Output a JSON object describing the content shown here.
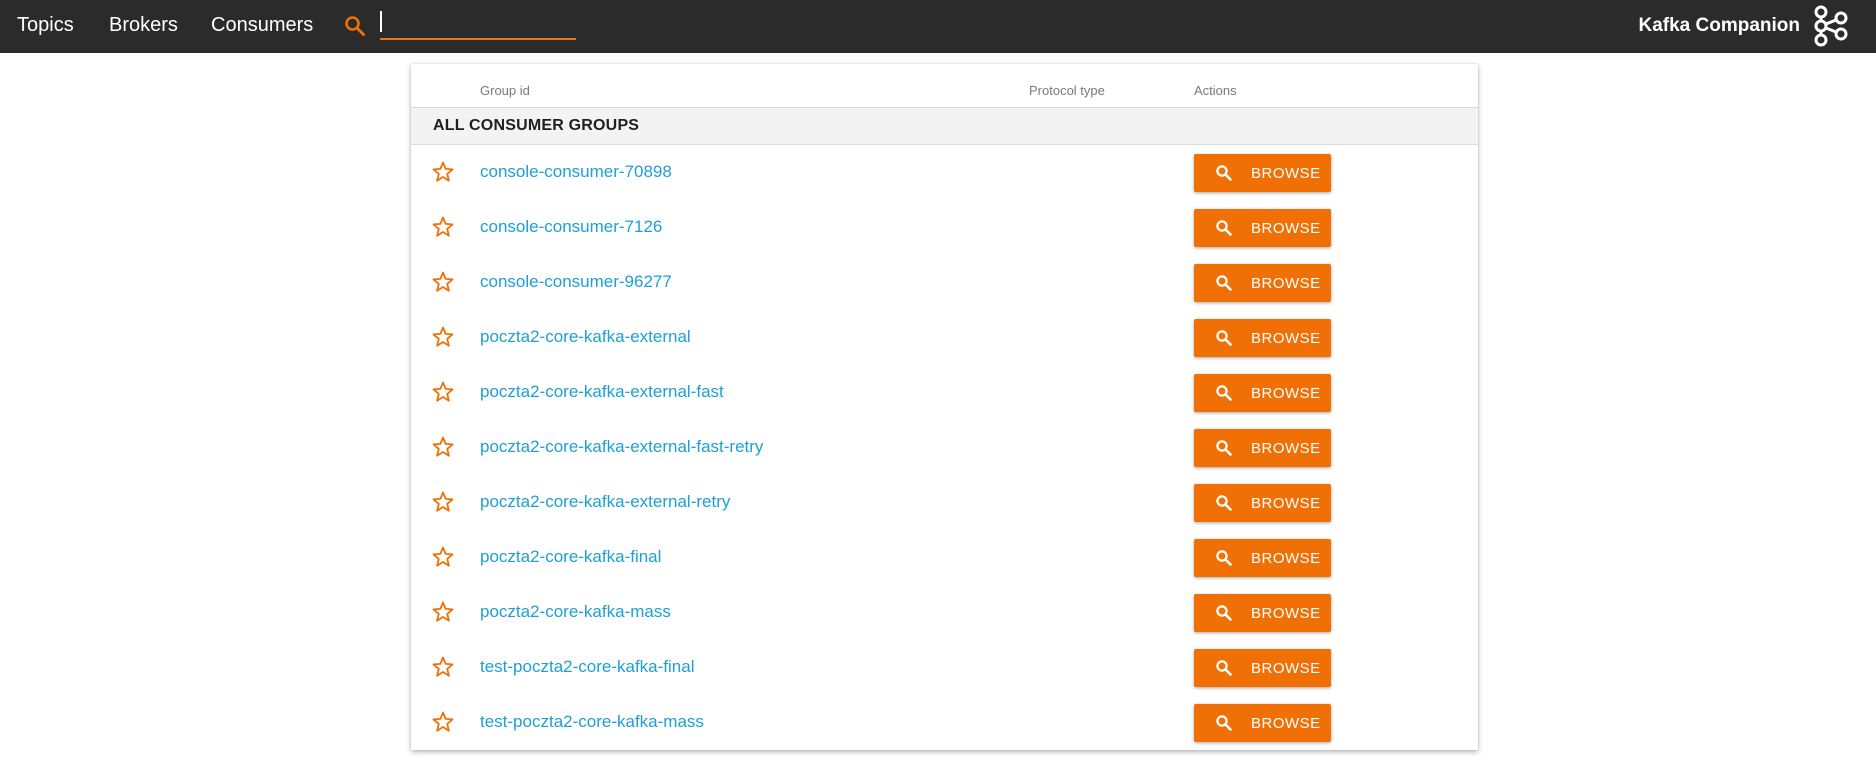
{
  "nav": {
    "topics": "Topics",
    "brokers": "Brokers",
    "consumers": "Consumers"
  },
  "search": {
    "value": "",
    "placeholder": ""
  },
  "brand": {
    "name": "Kafka Companion",
    "logo_icon": "kafka-logo-icon"
  },
  "table": {
    "columns": {
      "group_id": "Group id",
      "protocol_type": "Protocol type",
      "actions": "Actions"
    },
    "section_title": "ALL CONSUMER GROUPS",
    "browse_label": "BROWSE",
    "rows": [
      {
        "group_id": "console-consumer-70898",
        "protocol_type": ""
      },
      {
        "group_id": "console-consumer-7126",
        "protocol_type": ""
      },
      {
        "group_id": "console-consumer-96277",
        "protocol_type": ""
      },
      {
        "group_id": "poczta2-core-kafka-external",
        "protocol_type": ""
      },
      {
        "group_id": "poczta2-core-kafka-external-fast",
        "protocol_type": ""
      },
      {
        "group_id": "poczta2-core-kafka-external-fast-retry",
        "protocol_type": ""
      },
      {
        "group_id": "poczta2-core-kafka-external-retry",
        "protocol_type": ""
      },
      {
        "group_id": "poczta2-core-kafka-final",
        "protocol_type": ""
      },
      {
        "group_id": "poczta2-core-kafka-mass",
        "protocol_type": ""
      },
      {
        "group_id": "test-poczta2-core-kafka-final",
        "protocol_type": ""
      },
      {
        "group_id": "test-poczta2-core-kafka-mass",
        "protocol_type": ""
      }
    ]
  },
  "colors": {
    "topbar": "#2b2b2b",
    "accent": "#f07006",
    "link": "#1e9fd6"
  },
  "icons": {
    "search": "search-icon",
    "star": "star-outline-icon",
    "browse": "magnifier-icon"
  }
}
